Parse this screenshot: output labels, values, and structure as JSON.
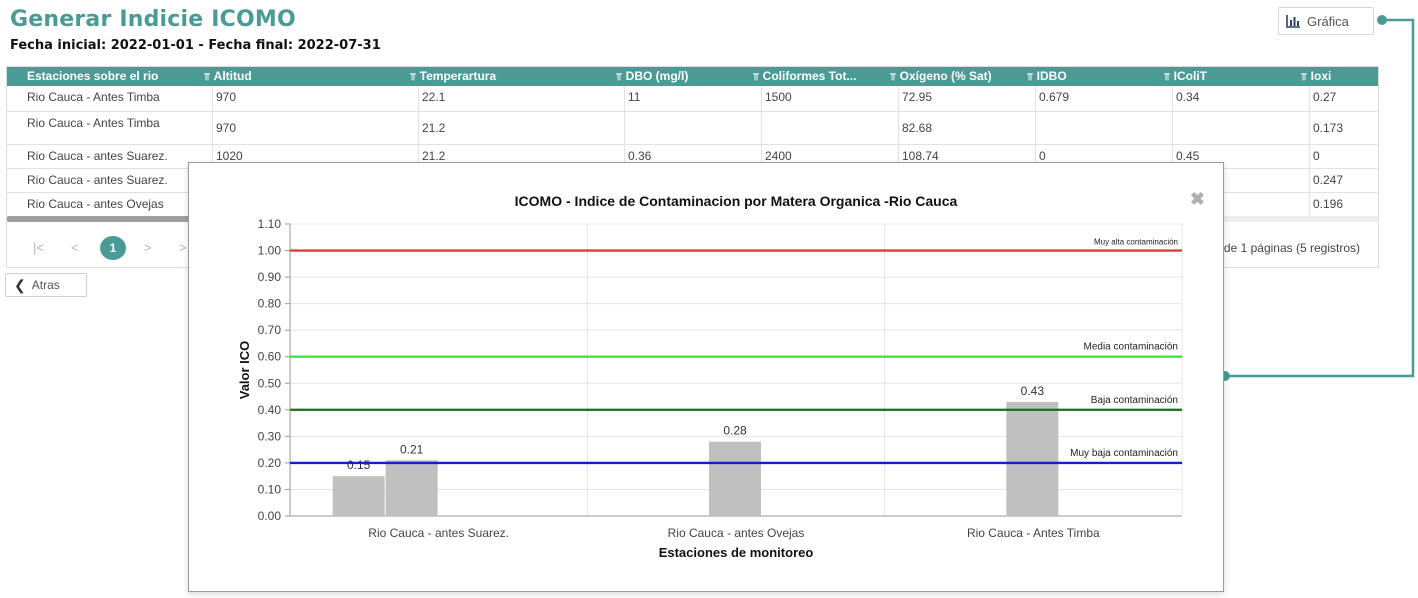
{
  "page": {
    "title": "Generar Indicie ICOMO",
    "subtitle": "Fecha inicial: 2022-01-01 - Fecha final: 2022-07-31",
    "chart_button": "Gráfica",
    "back_button": "Atras",
    "accent_color": "#4a9a96"
  },
  "table": {
    "columns": [
      "Estaciones sobre el rio",
      "Altitud",
      "Temperartura",
      "DBO (mg/l)",
      "Coliformes Tot...",
      "Oxígeno (% Sat)",
      "IDBO",
      "IColiT",
      "Ioxi"
    ],
    "rows": [
      [
        "Rio Cauca - Antes Timba",
        "970",
        "22.1",
        "11",
        "1500",
        "72.95",
        "0.679",
        "0.34",
        "0.27"
      ],
      [
        "Rio Cauca - Antes Timba",
        "970",
        "21.2",
        "",
        "",
        "82.68",
        "",
        "",
        "0.173"
      ],
      [
        "Rio Cauca - antes Suarez.",
        "1020",
        "21.2",
        "0.36",
        "2400",
        "108.74",
        "0",
        "0.45",
        "0"
      ],
      [
        "Rio Cauca - antes Suarez.",
        "",
        "",
        "",
        "",
        "",
        "",
        "",
        "0.247"
      ],
      [
        "Rio Cauca - antes Ovejas",
        "",
        "",
        "",
        "",
        "",
        "",
        "",
        "0.196"
      ]
    ],
    "pager": {
      "first": "|<",
      "prev": "<",
      "current": "1",
      "next": ">",
      "last": ">",
      "info": "de 1 páginas (5 registros)"
    }
  },
  "chart_modal": {
    "close_icon": "close-x-icon"
  },
  "chart_data": {
    "type": "bar",
    "title": "ICOMO - Indice de Contaminacion por Matera Organica -Rio Cauca",
    "xlabel": "Estaciones de monitoreo",
    "ylabel": "Valor ICO",
    "ylim": [
      0,
      1.1
    ],
    "yticks": [
      "0.00",
      "0.10",
      "0.20",
      "0.30",
      "0.40",
      "0.50",
      "0.60",
      "0.70",
      "0.80",
      "0.90",
      "1.00",
      "1.10"
    ],
    "categories": [
      "Rio Cauca - antes Suarez.",
      "Rio Cauca - antes Ovejas",
      "Rio Cauca - Antes Timba"
    ],
    "bars": [
      {
        "category": 0,
        "slot": 0,
        "value": 0.15,
        "label": "0.15"
      },
      {
        "category": 0,
        "slot": 1,
        "value": 0.21,
        "label": "0.21"
      },
      {
        "category": 1,
        "slot": 1,
        "value": 0.28,
        "label": "0.28"
      },
      {
        "category": 2,
        "slot": 1,
        "value": 0.43,
        "label": "0.43"
      }
    ],
    "bar_color": "#c0c0c0",
    "reference_lines": [
      {
        "value": 1.0,
        "label": "Muy alta contaminación",
        "color": "#e53935"
      },
      {
        "value": 0.6,
        "label": "Media contaminación",
        "color": "#4cdb4c"
      },
      {
        "value": 0.4,
        "label": "Baja contaminación",
        "color": "#1b7a1b"
      },
      {
        "value": 0.2,
        "label": "Muy baja contaminación",
        "color": "#1a1ad6"
      }
    ],
    "grid": true
  }
}
